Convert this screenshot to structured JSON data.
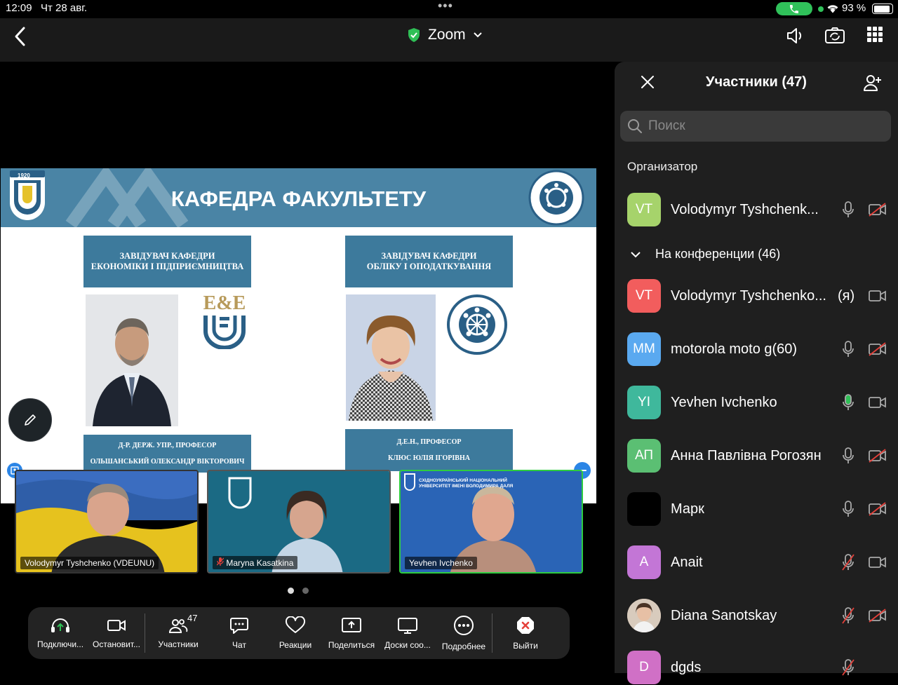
{
  "status": {
    "time": "12:09",
    "date": "Чт 28 авг.",
    "battery": "93 %"
  },
  "topbar": {
    "title": "Zoom"
  },
  "slide": {
    "title": "КАФЕДРА ФАКУЛЬТЕТУ",
    "left_box": [
      "ЗАВІДУВАЧ КАФЕДРИ",
      "ЕКОНОМІКИ І ПІДПРИЄМНИЦТВА"
    ],
    "right_box": [
      "ЗАВІДУВАЧ КАФЕДРИ",
      "ОБЛІКУ І ОПОДАТКУВАННЯ"
    ],
    "left_caption": [
      "Д-Р. ДЕРЖ. УПР., ПРОФЕСОР",
      "ОЛЬШАНСЬКИЙ ОЛЕКСАНДР ВІКТОРОВИЧ"
    ],
    "right_caption": [
      "Д.Е.Н., ПРОФЕСОР",
      "КЛЮС ЮЛІЯ ІГОРІВНА"
    ],
    "ee_logo": "E&E",
    "year": "1920"
  },
  "thumbs": [
    {
      "name": "Volodymyr Tyshchenko (VDEUNU)"
    },
    {
      "name": "Maryna Kasatkina"
    },
    {
      "name": "Yevhen Ivchenko",
      "banner": "СХІДНОУКРАЇНСЬКИЙ НАЦІОНАЛЬНИЙ УНІВЕРСИТЕТ ІМЕНІ ВОЛОДИМИРА ДАЛЯ"
    }
  ],
  "toolbar": {
    "audio": "Подключи...",
    "video": "Остановит...",
    "participants": "Участники",
    "participants_count": "47",
    "chat": "Чат",
    "reactions": "Реакции",
    "share": "Поделиться",
    "whiteboards": "Доски соо...",
    "more": "Подробнее",
    "leave": "Выйти"
  },
  "panel": {
    "title": "Участники (47)",
    "search_placeholder": "Поиск",
    "host_section": "Организатор",
    "conf_section": "На конференции (46)",
    "host": {
      "initials": "VT",
      "name": "Volodymyr Tyshchenk...",
      "color": "#a6d36b"
    },
    "participants": [
      {
        "initials": "VT",
        "name": "Volodymyr Tyshchenko...",
        "suffix": "(я)",
        "color": "#f25d5d"
      },
      {
        "initials": "MM",
        "name": "motorola moto g(60)",
        "color": "#5aa9f0"
      },
      {
        "initials": "YI",
        "name": "Yevhen Ivchenko",
        "color": "#3fb89c"
      },
      {
        "initials": "АП",
        "name": "Анна Павлівна Рогозян",
        "color": "#5bbf73"
      },
      {
        "initials": "",
        "name": "Марк",
        "color": "#000000"
      },
      {
        "initials": "A",
        "name": "Anait",
        "color": "#c376d6"
      },
      {
        "initials": "",
        "name": "Diana Sanotskay",
        "color": "#c9a98b"
      },
      {
        "initials": "D",
        "name": "dgds",
        "color": "#d070c6"
      }
    ]
  }
}
